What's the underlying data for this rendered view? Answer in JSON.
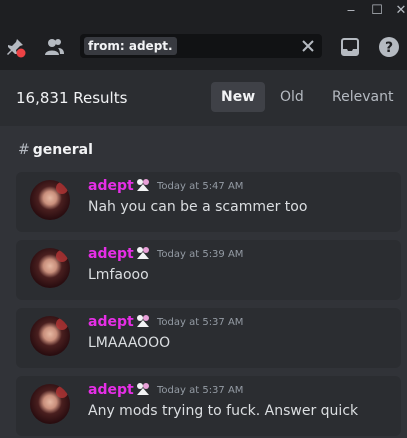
{
  "search": {
    "query": "from: adept."
  },
  "results": {
    "count_label": "16,831 Results"
  },
  "sort_tabs": [
    {
      "label": "New",
      "active": true
    },
    {
      "label": "Old",
      "active": false
    },
    {
      "label": "Relevant",
      "active": false
    }
  ],
  "channel": {
    "hash": "#",
    "name": "general"
  },
  "messages": [
    {
      "author": "adept",
      "timestamp": "Today at 5:47 AM",
      "text": "Nah you can be a scammer too"
    },
    {
      "author": "adept",
      "timestamp": "Today at 5:39 AM",
      "text": "Lmfaooo"
    },
    {
      "author": "adept",
      "timestamp": "Today at 5:37 AM",
      "text": "LMAAAOOO"
    },
    {
      "author": "adept",
      "timestamp": "Today at 5:37 AM",
      "text": "Any mods trying to fuck. Answer quick"
    }
  ],
  "colors": {
    "author": "#e62ee6",
    "background": "#313338",
    "card": "#2b2d31",
    "accent_red": "#ed4245"
  },
  "icons": [
    "minimize-icon",
    "maximize-icon",
    "close-icon",
    "pin-icon",
    "members-icon",
    "clear-search-icon",
    "inbox-icon",
    "help-icon",
    "author-badge-icon"
  ]
}
